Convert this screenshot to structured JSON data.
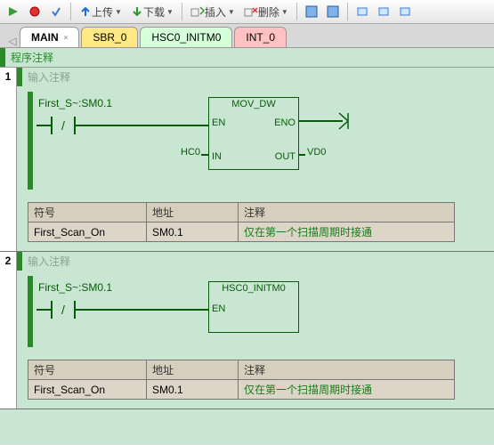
{
  "toolbar": {
    "upload": "上传",
    "download": "下载",
    "insert": "插入",
    "delete": "删除"
  },
  "tabs": {
    "main": "MAIN",
    "sbr": "SBR_0",
    "hsc": "HSC0_INITM0",
    "int_": "INT_0"
  },
  "prog_comment": "程序注释",
  "rung1": {
    "no": "1",
    "in_comment": "输入注释",
    "sym": "First_S~:SM0.1",
    "box": {
      "title": "MOV_DW",
      "en": "EN",
      "eno": "ENO",
      "in": "IN",
      "out": "OUT",
      "in_src": "HC0",
      "out_dst": "VD0"
    },
    "table": {
      "h1": "符号",
      "h2": "地址",
      "h3": "注释",
      "c1": "First_Scan_On",
      "c2": "SM0.1",
      "c3": "仅在第一个扫描周期时接通"
    }
  },
  "rung2": {
    "no": "2",
    "in_comment": "输入注释",
    "sym": "First_S~:SM0.1",
    "box": {
      "title": "HSC0_INITM0",
      "en": "EN"
    },
    "table": {
      "h1": "符号",
      "h2": "地址",
      "h3": "注释",
      "c1": "First_Scan_On",
      "c2": "SM0.1",
      "c3": "仅在第一个扫描周期时接通"
    }
  }
}
